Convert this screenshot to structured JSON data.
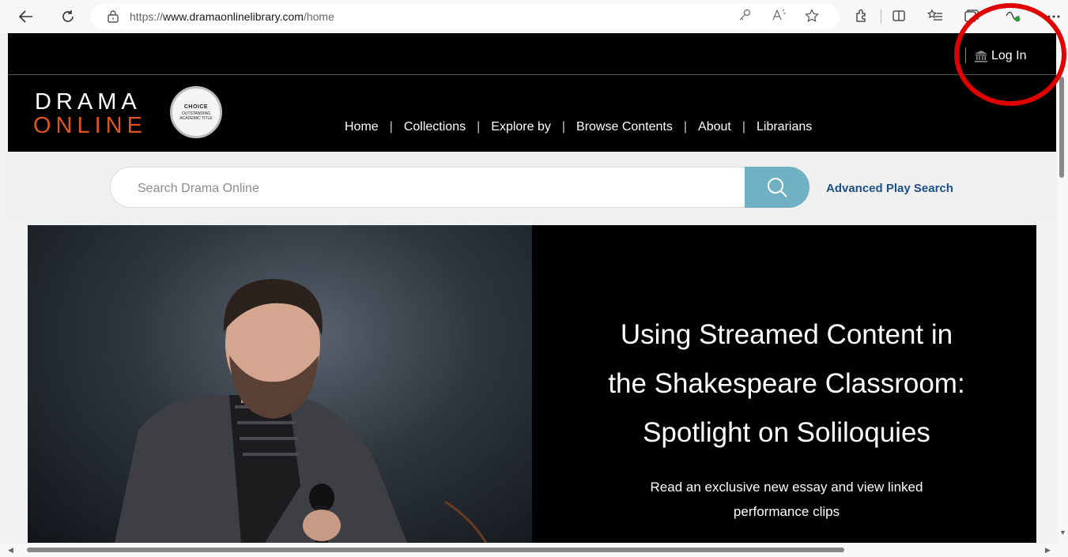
{
  "browser": {
    "url_prefix": "https://",
    "url_host": "www.dramaonlinelibrary.com",
    "url_path": "/home"
  },
  "site": {
    "login_label": "Log In",
    "logo_line1": "DRAMA",
    "logo_line2": "ONLINE",
    "badge_top": "CHOICE",
    "badge_sub": "OUTSTANDING ACADEMIC TITLE",
    "nav": [
      {
        "label": "Home"
      },
      {
        "label": "Collections"
      },
      {
        "label": "Explore by"
      },
      {
        "label": "Browse Contents"
      },
      {
        "label": "About"
      },
      {
        "label": "Librarians"
      }
    ],
    "search": {
      "placeholder": "Search Drama Online",
      "value": ""
    },
    "advanced_search_label": "Advanced Play Search",
    "hero": {
      "title_line1": "Using Streamed Content in",
      "title_line2": "the Shakespeare Classroom:",
      "title_line3": "Spotlight on Soliloquies",
      "sub_line1": "Read an exclusive new essay and view linked",
      "sub_line2": "performance clips"
    }
  },
  "colors": {
    "accent_orange": "#e0541f",
    "search_button": "#6fb1c2",
    "link_blue": "#1d4f8a",
    "annotation_red": "#e00000"
  },
  "icons": [
    "back-arrow-icon",
    "refresh-icon",
    "lock-icon",
    "key-icon",
    "read-aloud-icon",
    "favorite-star-icon",
    "extensions-icon",
    "split-screen-icon",
    "favorites-list-icon",
    "collections-icon",
    "performance-icon",
    "more-icon",
    "institution-icon",
    "search-icon"
  ]
}
